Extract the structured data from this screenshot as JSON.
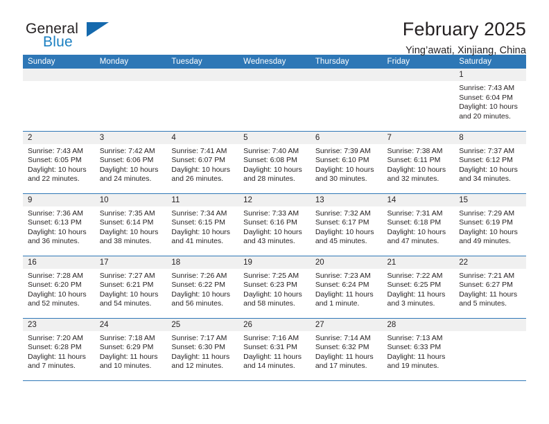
{
  "brand": {
    "name_part1": "General",
    "name_part2": "Blue",
    "flag_icon": "triangle-flag-icon"
  },
  "header": {
    "month_title": "February 2025",
    "location": "Ying’awati, Xinjiang, China"
  },
  "colors": {
    "header_blue": "#2e77b6",
    "brand_blue": "#1a7fc1",
    "daynum_band": "#f0f0f0",
    "text": "#231f20"
  },
  "weekday_headers": [
    "Sunday",
    "Monday",
    "Tuesday",
    "Wednesday",
    "Thursday",
    "Friday",
    "Saturday"
  ],
  "weeks": [
    [
      {
        "day": "",
        "sunrise": "",
        "sunset": "",
        "daylight": ""
      },
      {
        "day": "",
        "sunrise": "",
        "sunset": "",
        "daylight": ""
      },
      {
        "day": "",
        "sunrise": "",
        "sunset": "",
        "daylight": ""
      },
      {
        "day": "",
        "sunrise": "",
        "sunset": "",
        "daylight": ""
      },
      {
        "day": "",
        "sunrise": "",
        "sunset": "",
        "daylight": ""
      },
      {
        "day": "",
        "sunrise": "",
        "sunset": "",
        "daylight": ""
      },
      {
        "day": "1",
        "sunrise": "Sunrise: 7:43 AM",
        "sunset": "Sunset: 6:04 PM",
        "daylight": "Daylight: 10 hours and 20 minutes."
      }
    ],
    [
      {
        "day": "2",
        "sunrise": "Sunrise: 7:43 AM",
        "sunset": "Sunset: 6:05 PM",
        "daylight": "Daylight: 10 hours and 22 minutes."
      },
      {
        "day": "3",
        "sunrise": "Sunrise: 7:42 AM",
        "sunset": "Sunset: 6:06 PM",
        "daylight": "Daylight: 10 hours and 24 minutes."
      },
      {
        "day": "4",
        "sunrise": "Sunrise: 7:41 AM",
        "sunset": "Sunset: 6:07 PM",
        "daylight": "Daylight: 10 hours and 26 minutes."
      },
      {
        "day": "5",
        "sunrise": "Sunrise: 7:40 AM",
        "sunset": "Sunset: 6:08 PM",
        "daylight": "Daylight: 10 hours and 28 minutes."
      },
      {
        "day": "6",
        "sunrise": "Sunrise: 7:39 AM",
        "sunset": "Sunset: 6:10 PM",
        "daylight": "Daylight: 10 hours and 30 minutes."
      },
      {
        "day": "7",
        "sunrise": "Sunrise: 7:38 AM",
        "sunset": "Sunset: 6:11 PM",
        "daylight": "Daylight: 10 hours and 32 minutes."
      },
      {
        "day": "8",
        "sunrise": "Sunrise: 7:37 AM",
        "sunset": "Sunset: 6:12 PM",
        "daylight": "Daylight: 10 hours and 34 minutes."
      }
    ],
    [
      {
        "day": "9",
        "sunrise": "Sunrise: 7:36 AM",
        "sunset": "Sunset: 6:13 PM",
        "daylight": "Daylight: 10 hours and 36 minutes."
      },
      {
        "day": "10",
        "sunrise": "Sunrise: 7:35 AM",
        "sunset": "Sunset: 6:14 PM",
        "daylight": "Daylight: 10 hours and 38 minutes."
      },
      {
        "day": "11",
        "sunrise": "Sunrise: 7:34 AM",
        "sunset": "Sunset: 6:15 PM",
        "daylight": "Daylight: 10 hours and 41 minutes."
      },
      {
        "day": "12",
        "sunrise": "Sunrise: 7:33 AM",
        "sunset": "Sunset: 6:16 PM",
        "daylight": "Daylight: 10 hours and 43 minutes."
      },
      {
        "day": "13",
        "sunrise": "Sunrise: 7:32 AM",
        "sunset": "Sunset: 6:17 PM",
        "daylight": "Daylight: 10 hours and 45 minutes."
      },
      {
        "day": "14",
        "sunrise": "Sunrise: 7:31 AM",
        "sunset": "Sunset: 6:18 PM",
        "daylight": "Daylight: 10 hours and 47 minutes."
      },
      {
        "day": "15",
        "sunrise": "Sunrise: 7:29 AM",
        "sunset": "Sunset: 6:19 PM",
        "daylight": "Daylight: 10 hours and 49 minutes."
      }
    ],
    [
      {
        "day": "16",
        "sunrise": "Sunrise: 7:28 AM",
        "sunset": "Sunset: 6:20 PM",
        "daylight": "Daylight: 10 hours and 52 minutes."
      },
      {
        "day": "17",
        "sunrise": "Sunrise: 7:27 AM",
        "sunset": "Sunset: 6:21 PM",
        "daylight": "Daylight: 10 hours and 54 minutes."
      },
      {
        "day": "18",
        "sunrise": "Sunrise: 7:26 AM",
        "sunset": "Sunset: 6:22 PM",
        "daylight": "Daylight: 10 hours and 56 minutes."
      },
      {
        "day": "19",
        "sunrise": "Sunrise: 7:25 AM",
        "sunset": "Sunset: 6:23 PM",
        "daylight": "Daylight: 10 hours and 58 minutes."
      },
      {
        "day": "20",
        "sunrise": "Sunrise: 7:23 AM",
        "sunset": "Sunset: 6:24 PM",
        "daylight": "Daylight: 11 hours and 1 minute."
      },
      {
        "day": "21",
        "sunrise": "Sunrise: 7:22 AM",
        "sunset": "Sunset: 6:25 PM",
        "daylight": "Daylight: 11 hours and 3 minutes."
      },
      {
        "day": "22",
        "sunrise": "Sunrise: 7:21 AM",
        "sunset": "Sunset: 6:27 PM",
        "daylight": "Daylight: 11 hours and 5 minutes."
      }
    ],
    [
      {
        "day": "23",
        "sunrise": "Sunrise: 7:20 AM",
        "sunset": "Sunset: 6:28 PM",
        "daylight": "Daylight: 11 hours and 7 minutes."
      },
      {
        "day": "24",
        "sunrise": "Sunrise: 7:18 AM",
        "sunset": "Sunset: 6:29 PM",
        "daylight": "Daylight: 11 hours and 10 minutes."
      },
      {
        "day": "25",
        "sunrise": "Sunrise: 7:17 AM",
        "sunset": "Sunset: 6:30 PM",
        "daylight": "Daylight: 11 hours and 12 minutes."
      },
      {
        "day": "26",
        "sunrise": "Sunrise: 7:16 AM",
        "sunset": "Sunset: 6:31 PM",
        "daylight": "Daylight: 11 hours and 14 minutes."
      },
      {
        "day": "27",
        "sunrise": "Sunrise: 7:14 AM",
        "sunset": "Sunset: 6:32 PM",
        "daylight": "Daylight: 11 hours and 17 minutes."
      },
      {
        "day": "28",
        "sunrise": "Sunrise: 7:13 AM",
        "sunset": "Sunset: 6:33 PM",
        "daylight": "Daylight: 11 hours and 19 minutes."
      },
      {
        "day": "",
        "sunrise": "",
        "sunset": "",
        "daylight": ""
      }
    ]
  ]
}
